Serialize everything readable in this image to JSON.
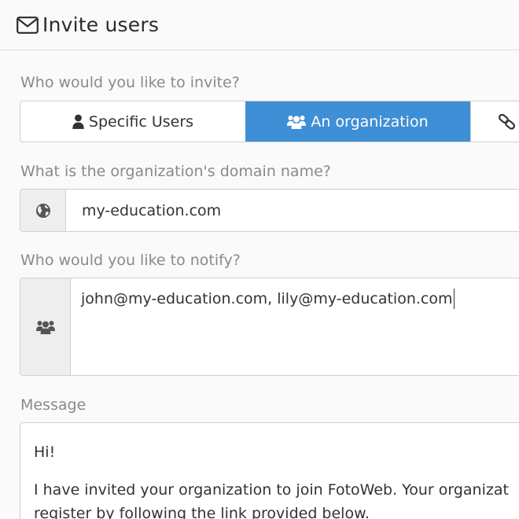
{
  "header": {
    "title": "Invite users",
    "icon": "envelope-icon"
  },
  "invite_type": {
    "label": "Who would you like to invite?",
    "options": [
      {
        "label": "Specific Users",
        "icon": "user-icon",
        "selected": false
      },
      {
        "label": "An organization",
        "icon": "users-icon",
        "selected": true
      },
      {
        "label": "",
        "icon": "link-icon",
        "selected": false
      }
    ],
    "active_color": "#3f8fd6"
  },
  "domain": {
    "label": "What is the organization's domain name?",
    "value": "my-education.com",
    "icon": "globe-icon"
  },
  "notify": {
    "label": "Who would you like to notify?",
    "value": "john@my-education.com, lily@my-education.com",
    "icon": "users-icon"
  },
  "message": {
    "label": "Message",
    "lines": [
      "Hi!",
      "I have invited your organization to join FotoWeb. Your organizat",
      "register by following the link provided below."
    ]
  }
}
